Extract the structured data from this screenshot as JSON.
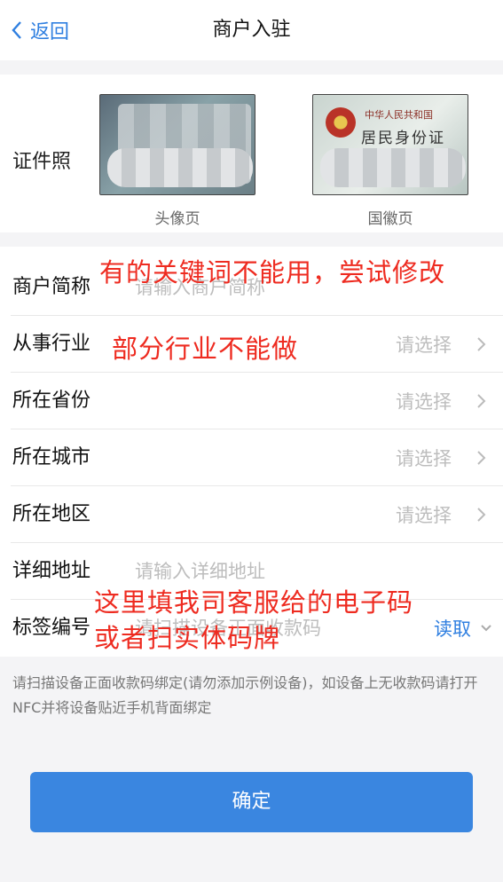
{
  "nav": {
    "back_label": "返回",
    "title": "商户入驻"
  },
  "id_photo": {
    "label": "证件照",
    "front_caption": "头像页",
    "back_caption": "国徽页",
    "back_card_line1": "中华人民共和国",
    "back_card_line2": "居民身份证"
  },
  "form": {
    "merchant_name": {
      "label": "商户简称",
      "placeholder": "请输入商户简称"
    },
    "industry": {
      "label": "从事行业",
      "value": "请选择"
    },
    "province": {
      "label": "所在省份",
      "value": "请选择"
    },
    "city": {
      "label": "所在城市",
      "value": "请选择"
    },
    "district": {
      "label": "所在地区",
      "value": "请选择"
    },
    "address": {
      "label": "详细地址",
      "placeholder": "请输入详细地址"
    },
    "tag": {
      "label": "标签编号",
      "placeholder": "请扫描设备正面收款码",
      "read_label": "读取"
    }
  },
  "hint": "请扫描设备正面收款码绑定(请勿添加示例设备)，如设备上无收款码请打开NFC并将设备贴近手机背面绑定",
  "confirm_label": "确定",
  "annotations": {
    "keywords": "有的关键词不能用，尝试修改",
    "industry": "部分行业不能做",
    "code_line1": "这里填我司客服给的电子码",
    "code_line2": "或者扫实体码牌"
  },
  "colors": {
    "accent": "#3a86e0",
    "annotation": "#ee2b20"
  }
}
